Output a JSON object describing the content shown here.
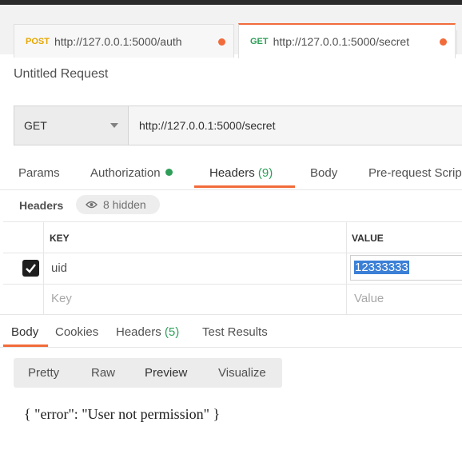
{
  "tabs": [
    {
      "method": "POST",
      "url": "http://127.0.0.1:5000/auth"
    },
    {
      "method": "GET",
      "url": "http://127.0.0.1:5000/secret"
    }
  ],
  "request": {
    "title": "Untitled Request",
    "method": "GET",
    "url": "http://127.0.0.1:5000/secret"
  },
  "request_tabs": {
    "params": "Params",
    "authorization": "Authorization",
    "headers": "Headers",
    "headers_count": "(9)",
    "body": "Body",
    "prerequest": "Pre-request Scrip"
  },
  "headers_section": {
    "label": "Headers",
    "hidden": "8 hidden",
    "col_key": "KEY",
    "col_value": "VALUE",
    "rows": [
      {
        "key": "uid",
        "value": "12333333",
        "checked": true
      }
    ],
    "key_placeholder": "Key",
    "value_placeholder": "Value"
  },
  "response_tabs": {
    "body": "Body",
    "cookies": "Cookies",
    "headers": "Headers",
    "headers_count": "(5)",
    "test_results": "Test Results"
  },
  "view_modes": {
    "pretty": "Pretty",
    "raw": "Raw",
    "preview": "Preview",
    "visualize": "Visualize"
  },
  "response_body": "{ \"error\": \"User not permission\" }",
  "colors": {
    "accent": "#f26b3a",
    "post": "#e5a700",
    "get": "#2e9e58",
    "selection": "#3b7fd6"
  }
}
